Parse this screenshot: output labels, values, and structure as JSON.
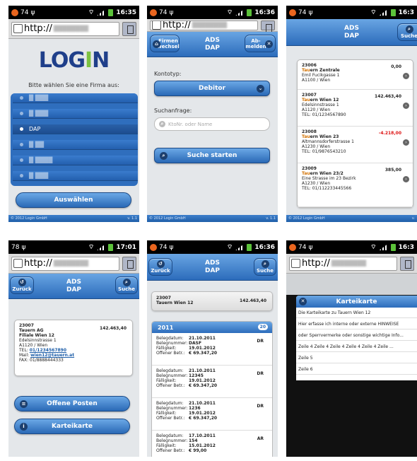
{
  "s1": {
    "status_left": "74",
    "time": "16:35",
    "url": "http://",
    "logo_a": "LOG",
    "logo_b": "N",
    "prompt": "Bitte wählen Sie eine Firma aus:",
    "selected": "DAP",
    "button": "Auswählen",
    "footer_left": "© 2012 Login GmbH",
    "footer_right": "v. 1.1"
  },
  "s2": {
    "status_left": "74",
    "time": "16:36",
    "url": "http://",
    "btn_left": "Firmen wechsel",
    "title1": "ADS",
    "title2": "DAP",
    "btn_right": "Ab-melden",
    "kontotyp_label": "Kontotyp:",
    "kontotyp_value": "Debitor",
    "search_label": "Suchanfrage:",
    "search_placeholder": "KtoNr. oder Name",
    "search_button": "Suche starten",
    "footer_left": "© 2012 Login GmbH",
    "footer_right": "v. 1.1"
  },
  "s3": {
    "status_left": "74",
    "time": "16:3",
    "title1": "ADS",
    "title2": "DAP",
    "btn_right": "Suche",
    "footer_left": "© 2012 Login GmbH",
    "footer_right": "v.",
    "customers": [
      {
        "nr": "23006",
        "hl": "Tau",
        "name_rest": "ern Zentrale",
        "addr1": "Emil Fucikgasse 1",
        "addr2": "A1100 / Wien",
        "tel": "",
        "amount": "0,00",
        "amount_color": "#222"
      },
      {
        "nr": "23007",
        "hl": "Tau",
        "name_rest": "ern Wien 12",
        "addr1": "Edelsinnstrasse 1",
        "addr2": "A1120 / Wien",
        "tel": "TEL: 01/1234567890",
        "amount": "142.463,40",
        "amount_color": "#222"
      },
      {
        "nr": "23008",
        "hl": "Tau",
        "name_rest": "ern Wien 23",
        "addr1": "Altmannsdorferstrasse 1",
        "addr2": "A1230 / Wien",
        "tel": "TEL: 01/9876543210",
        "amount": "-4.218,00",
        "amount_color": "#d11"
      },
      {
        "nr": "23009",
        "hl": "Tau",
        "name_rest": "ern Wien 23/2",
        "addr1": "Eine Strasse im 23 Bezirk",
        "addr2": "A1230 / Wien",
        "tel": "TEL: 01/112233445566",
        "amount": "385,00",
        "amount_color": "#222"
      }
    ]
  },
  "s4": {
    "status_left": "78",
    "time": "17:01",
    "url": "http://",
    "btn_left": "Zurück",
    "title1": "ADS",
    "title2": "DAP",
    "btn_right": "Suche",
    "nr": "23007",
    "amount": "142.463,40",
    "name1": "Tauern AG",
    "name2": "Filiale Wien 12",
    "addr1": "Edelsinnstrasse 1",
    "addr2": "A1120 / Wien",
    "tel_label": "TEL: ",
    "tel": "01/1234567890",
    "mail_label": "Mail: ",
    "mail": "wien12@tauern.at",
    "fax": "FAX: 01/8888444333",
    "btn_posten": "Offene Posten",
    "btn_kartei": "Karteikarte"
  },
  "s5": {
    "status_left": "74",
    "time": "16:36",
    "btn_left": "Zurück",
    "title1": "ADS",
    "title2": "DAP",
    "btn_right": "Suche",
    "nr": "23007",
    "name": "Tauern Wien 12",
    "amount": "142.463,40",
    "year": "2011",
    "count": "20",
    "labels": {
      "d": "Belegdatum:",
      "n": "Belegnummer:",
      "f": "Fälligkeit:",
      "o": "Offener Betr.:"
    },
    "items": [
      {
        "d": "21.10.2011",
        "n": "DASF",
        "f": "19.01.2012",
        "o": "€ 69.347,20",
        "t": "DR"
      },
      {
        "d": "21.10.2011",
        "n": "12345",
        "f": "19.01.2012",
        "o": "€ 69.347,20",
        "t": "DR"
      },
      {
        "d": "21.10.2011",
        "n": "1236",
        "f": "19.01.2012",
        "o": "€ 69.347,20",
        "t": "DR"
      },
      {
        "d": "17.10.2011",
        "n": "154",
        "f": "15.01.2012",
        "o": "€ 99,00",
        "t": "AR"
      }
    ]
  },
  "s6": {
    "status_left": "74",
    "time": "16:3",
    "url": "http://",
    "dialog_title": "Karteikarte",
    "lines": [
      "Die Karteikarte zu Tauern Wien 12",
      "Hier erfasse ich interne oder externe HINWEISE",
      "oder Sperrvermerke oder sonstige wichtige Info...",
      "Zeile 4 Zeile 4 Zeile 4 Zeile 4 Zeile 4 Zeile ...",
      "Zeile 5",
      "Zeile 6"
    ]
  },
  "colors": {
    "accent": "#2c6cbb",
    "negative": "#d11",
    "logo_green": "#7cc242"
  }
}
